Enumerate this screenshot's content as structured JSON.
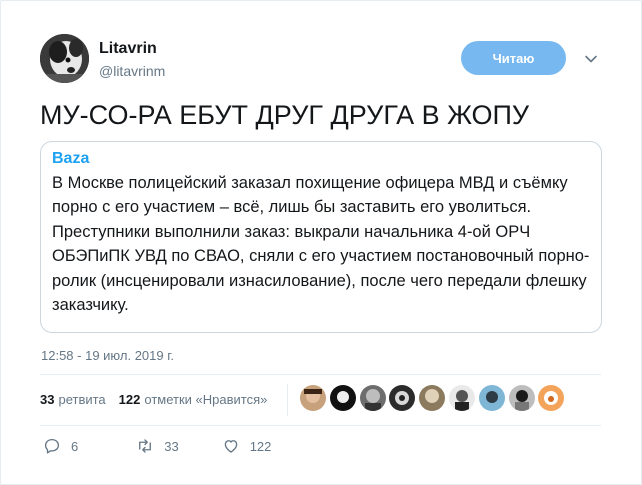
{
  "author": {
    "name": "Litavrin",
    "handle": "@litavrinm"
  },
  "follow_button": {
    "label": "Читаю"
  },
  "tweet": {
    "text": "МУ-СО-РА ЕБУТ ДРУГ ДРУГА В ЖОПУ"
  },
  "quote": {
    "author": "Baza",
    "text": "В Москве полицейский заказал похищение офицера МВД и съёмку порно с его участием – всё, лишь бы заставить его уволиться. Преступники выполнили заказ: выкрали начальника 4-ой ОРЧ ОБЭПиПК УВД по СВАО, сняли с его участием постановочный порно-ролик (инсценировали изнасилование), после чего передали флешку заказчику."
  },
  "timestamp": "12:58 - 19 июл. 2019 г.",
  "stats": {
    "retweets_count": "33",
    "retweets_label": "ретвита",
    "likes_count": "122",
    "likes_label": "отметки «Нравится»"
  },
  "actions": {
    "reply_count": "6",
    "retweet_count": "33",
    "like_count": "122"
  },
  "colors": {
    "accent": "#1da1f2",
    "follow_button": "#76b8ef",
    "muted": "#657786"
  }
}
